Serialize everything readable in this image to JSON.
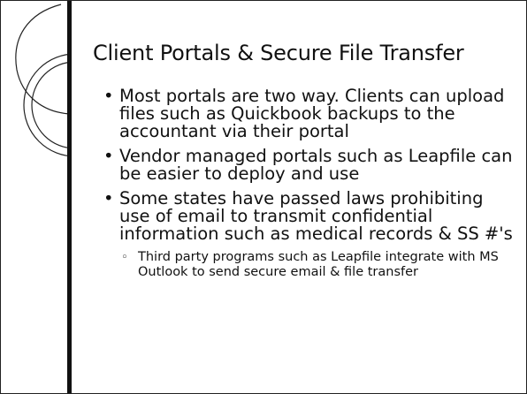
{
  "slide": {
    "title": "Client Portals & Secure File Transfer",
    "bullets": [
      "Most portals are two way. Clients can upload files such as Quickbook backups to the accountant via their portal",
      "Vendor managed portals such as Leapfile can be easier to deploy and use",
      "Some states have passed laws prohibiting use of email to transmit confidential information such as medical records & SS #'s"
    ],
    "sub_bullets": [
      "Third party programs such as Leapfile integrate with MS Outlook to send secure email & file transfer"
    ]
  }
}
